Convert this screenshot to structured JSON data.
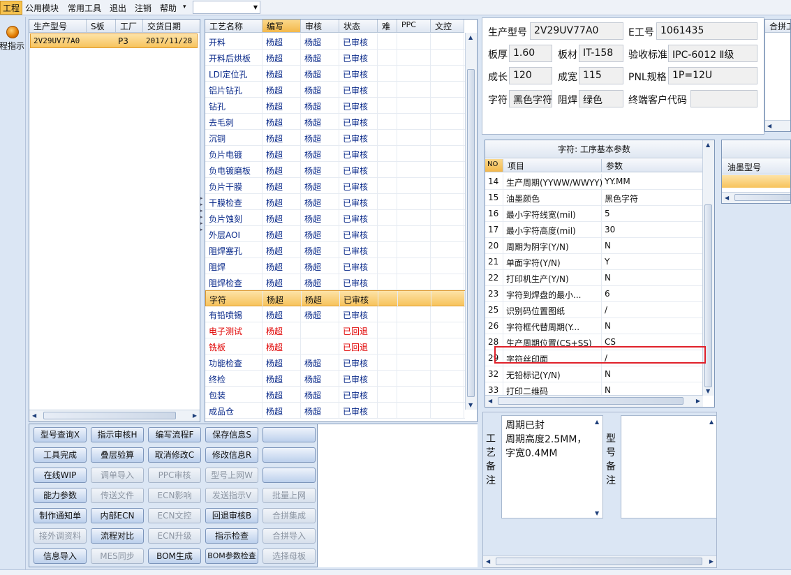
{
  "menubar": {
    "items": [
      "工程",
      "公用模块",
      "常用工具",
      "退出",
      "注销",
      "帮助",
      "▾"
    ]
  },
  "left_strip": {
    "guide_label": "程指示"
  },
  "orders": {
    "headers": [
      "生产型号",
      "S板",
      "工厂",
      "交货日期"
    ],
    "rows": [
      [
        "2V29UV77A0",
        "",
        "P3",
        "2017/11/28"
      ]
    ]
  },
  "process": {
    "headers": [
      "工艺名称",
      "编写",
      "审核",
      "状态",
      "难",
      "PPC",
      "文控"
    ],
    "rows": [
      {
        "name": "开料",
        "writer": "杨超",
        "reviewer": "杨超",
        "status": "已审核"
      },
      {
        "name": "开料后烘板",
        "writer": "杨超",
        "reviewer": "杨超",
        "status": "已审核"
      },
      {
        "name": "LDI定位孔",
        "writer": "杨超",
        "reviewer": "杨超",
        "status": "已审核"
      },
      {
        "name": "铝片钻孔",
        "writer": "杨超",
        "reviewer": "杨超",
        "status": "已审核"
      },
      {
        "name": "钻孔",
        "writer": "杨超",
        "reviewer": "杨超",
        "status": "已审核"
      },
      {
        "name": "去毛刺",
        "writer": "杨超",
        "reviewer": "杨超",
        "status": "已审核"
      },
      {
        "name": "沉铜",
        "writer": "杨超",
        "reviewer": "杨超",
        "status": "已审核"
      },
      {
        "name": "负片电镀",
        "writer": "杨超",
        "reviewer": "杨超",
        "status": "已审核"
      },
      {
        "name": "负电镀磨板",
        "writer": "杨超",
        "reviewer": "杨超",
        "status": "已审核"
      },
      {
        "name": "负片干膜",
        "writer": "杨超",
        "reviewer": "杨超",
        "status": "已审核"
      },
      {
        "name": "干膜检查",
        "writer": "杨超",
        "reviewer": "杨超",
        "status": "已审核"
      },
      {
        "name": "负片蚀刻",
        "writer": "杨超",
        "reviewer": "杨超",
        "status": "已审核"
      },
      {
        "name": "外层AOI",
        "writer": "杨超",
        "reviewer": "杨超",
        "status": "已审核"
      },
      {
        "name": "阻焊塞孔",
        "writer": "杨超",
        "reviewer": "杨超",
        "status": "已审核"
      },
      {
        "name": "阻焊",
        "writer": "杨超",
        "reviewer": "杨超",
        "status": "已审核"
      },
      {
        "name": "阻焊检查",
        "writer": "杨超",
        "reviewer": "杨超",
        "status": "已审核"
      },
      {
        "name": "字符",
        "writer": "杨超",
        "reviewer": "杨超",
        "status": "已审核"
      },
      {
        "name": "有铅喷锡",
        "writer": "杨超",
        "reviewer": "杨超",
        "status": "已审核"
      },
      {
        "name": "电子测试",
        "writer": "杨超",
        "reviewer": "",
        "status": "已回退"
      },
      {
        "name": "铣板",
        "writer": "杨超",
        "reviewer": "",
        "status": "已回退"
      },
      {
        "name": "功能检查",
        "writer": "杨超",
        "reviewer": "杨超",
        "status": "已审核"
      },
      {
        "name": "终检",
        "writer": "杨超",
        "reviewer": "杨超",
        "status": "已审核"
      },
      {
        "name": "包装",
        "writer": "杨超",
        "reviewer": "杨超",
        "status": "已审核"
      },
      {
        "name": "成品仓",
        "writer": "杨超",
        "reviewer": "杨超",
        "status": "已审核"
      }
    ],
    "selected_index": 16
  },
  "buttons": [
    {
      "label": "型号查询X",
      "enabled": true
    },
    {
      "label": "指示审核H",
      "enabled": true
    },
    {
      "label": "编写流程F",
      "enabled": true
    },
    {
      "label": "保存信息S",
      "enabled": true
    },
    {
      "label": "",
      "enabled": true
    },
    {
      "label": "工具完成",
      "enabled": true
    },
    {
      "label": "叠层验算",
      "enabled": true
    },
    {
      "label": "取消修改C",
      "enabled": true
    },
    {
      "label": "修改信息R",
      "enabled": true
    },
    {
      "label": "",
      "enabled": true
    },
    {
      "label": "在线WIP",
      "enabled": true
    },
    {
      "label": "调单导入",
      "enabled": false
    },
    {
      "label": "PPC审核",
      "enabled": false
    },
    {
      "label": "型号上网W",
      "enabled": false
    },
    {
      "label": "",
      "enabled": true
    },
    {
      "label": "能力参数",
      "enabled": true
    },
    {
      "label": "传送文件",
      "enabled": false
    },
    {
      "label": "ECN影响",
      "enabled": false
    },
    {
      "label": "发送指示V",
      "enabled": false
    },
    {
      "label": "批量上网",
      "enabled": false
    },
    {
      "label": "制作通知单",
      "enabled": true
    },
    {
      "label": "内部ECN",
      "enabled": true
    },
    {
      "label": "ECN文控",
      "enabled": false
    },
    {
      "label": "回退审核B",
      "enabled": true
    },
    {
      "label": "合拼集成",
      "enabled": false
    },
    {
      "label": "接外调资料",
      "enabled": false
    },
    {
      "label": "流程对比",
      "enabled": true
    },
    {
      "label": "ECN升级",
      "enabled": false
    },
    {
      "label": "指示检查",
      "enabled": true
    },
    {
      "label": "合拼导入",
      "enabled": false
    },
    {
      "label": "信息导入",
      "enabled": true
    },
    {
      "label": "MES同步",
      "enabled": false
    },
    {
      "label": "BOM生成",
      "enabled": true
    },
    {
      "label": "BOM参数检查",
      "enabled": true
    },
    {
      "label": "选择母板",
      "enabled": false
    }
  ],
  "info": {
    "model_label": "生产型号",
    "model": "2V29UV77A0",
    "e_label": "E工号",
    "e_no": "1061435",
    "thickness_label": "板厚",
    "thickness": "1.60",
    "material_label": "板材",
    "material": "IT-158",
    "standard_label": "验收标准",
    "standard": "IPC-6012 Ⅱ级",
    "length_label": "成长",
    "length": "120",
    "width_label": "成宽",
    "width": "115",
    "pnl_label": "PNL规格",
    "pnl": "1P=12U",
    "char_label": "字符",
    "char": "黑色字符",
    "mask_label": "阻焊",
    "mask": "绿色",
    "customer_label": "终端客户代码",
    "customer": ""
  },
  "right_edge": {
    "combine_header": "合拼工",
    "ink_header": "油墨型号"
  },
  "params": {
    "title": "字符: 工序基本参数",
    "headers": [
      "NO",
      "项目",
      "参数"
    ],
    "rows": [
      {
        "no": "14",
        "item": "生产周期(YYWW/WWYY)",
        "value": "YY.MM"
      },
      {
        "no": "15",
        "item": "油墨颜色",
        "value": "黑色字符"
      },
      {
        "no": "16",
        "item": "最小字符线宽(mil)",
        "value": "5"
      },
      {
        "no": "17",
        "item": "最小字符高度(mil)",
        "value": "30"
      },
      {
        "no": "20",
        "item": "周期为阴字(Y/N)",
        "value": "N"
      },
      {
        "no": "21",
        "item": "单面字符(Y/N)",
        "value": "Y"
      },
      {
        "no": "22",
        "item": "打印机生产(Y/N)",
        "value": "N"
      },
      {
        "no": "23",
        "item": "字符到焊盘的最小...",
        "value": "6"
      },
      {
        "no": "25",
        "item": "识别码位置图纸",
        "value": "/"
      },
      {
        "no": "26",
        "item": "字符框代替周期(Y...",
        "value": "N"
      },
      {
        "no": "28",
        "item": "生产周期位置(CS+SS)",
        "value": "CS"
      },
      {
        "no": "29",
        "item": "字符丝印面",
        "value": "/"
      },
      {
        "no": "32",
        "item": "无铅标记(Y/N)",
        "value": "N"
      },
      {
        "no": "33",
        "item": "打印二维码",
        "value": "N"
      }
    ],
    "highlight_index": 11
  },
  "notes": {
    "process_label": "工艺备注",
    "process_text": "周期已封\n周期高度2.5MM，字宽0.4MM",
    "model_label": "型号备注",
    "model_text": ""
  },
  "colors": {
    "accent": "#f7c35c",
    "highlight_border": "#e0202a",
    "rollback": "#e00000",
    "link_text": "#0a2a8a"
  }
}
